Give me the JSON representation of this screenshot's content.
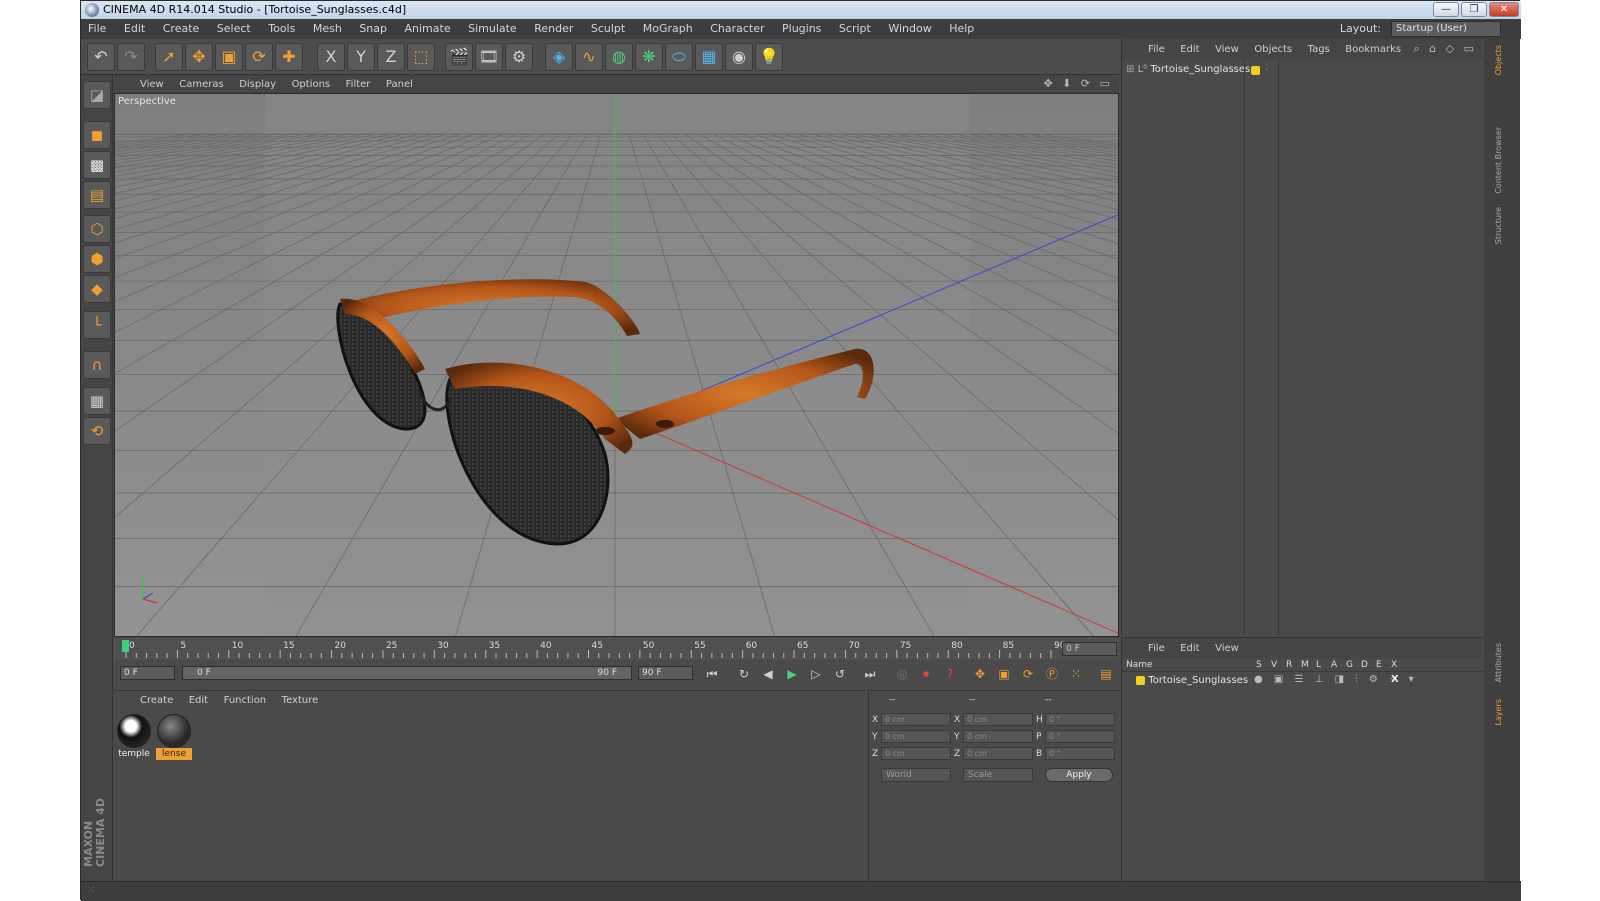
{
  "window": {
    "title": "CINEMA 4D R14.014 Studio - [Tortoise_Sunglasses.c4d]"
  },
  "menubar": {
    "items": [
      "File",
      "Edit",
      "Create",
      "Select",
      "Tools",
      "Mesh",
      "Snap",
      "Animate",
      "Simulate",
      "Render",
      "Sculpt",
      "MoGraph",
      "Character",
      "Plugins",
      "Script",
      "Window",
      "Help"
    ],
    "layout_label": "Layout:",
    "layout_value": "Startup (User)"
  },
  "toolbar": {
    "axis_x": "X",
    "axis_y": "Y",
    "axis_z": "Z"
  },
  "viewport": {
    "menu": [
      "View",
      "Cameras",
      "Display",
      "Options",
      "Filter",
      "Panel"
    ],
    "camera_label": "Perspective",
    "icon_strip": "✥ ⬇ ⟳ ▭"
  },
  "timeline": {
    "ticks": [
      "0",
      "5",
      "10",
      "15",
      "20",
      "25",
      "30",
      "35",
      "40",
      "45",
      "50",
      "55",
      "60",
      "65",
      "70",
      "75",
      "80",
      "85",
      "90"
    ],
    "current_frame": "0 F"
  },
  "playbar": {
    "start": "0 F",
    "range_start": "0 F",
    "range_end": "90 F",
    "end": "90 F"
  },
  "materials": {
    "menu": [
      "Create",
      "Edit",
      "Function",
      "Texture"
    ],
    "items": [
      {
        "name": "temple"
      },
      {
        "name": "lense"
      }
    ]
  },
  "coordinates": {
    "col_headers": [
      "--",
      "--",
      "--"
    ],
    "rows": [
      {
        "a": "X",
        "b": "X",
        "c": "H",
        "v1": "0 cm",
        "v2": "0 cm",
        "v3": "0 °"
      },
      {
        "a": "Y",
        "b": "Y",
        "c": "P",
        "v1": "0 cm",
        "v2": "0 cm",
        "v3": "0 °"
      },
      {
        "a": "Z",
        "b": "Z",
        "c": "B",
        "v1": "0 cm",
        "v2": "0 cm",
        "v3": "0 °"
      }
    ],
    "mode": "World",
    "scale": "Scale",
    "apply": "Apply"
  },
  "objects": {
    "menu": [
      "File",
      "Edit",
      "View",
      "Objects",
      "Tags",
      "Bookmarks"
    ],
    "tree": [
      {
        "name": "Tortoise_Sunglasses"
      }
    ]
  },
  "layers": {
    "menu": [
      "File",
      "Edit",
      "View"
    ],
    "col_name": "Name",
    "cols": [
      "S",
      "V",
      "R",
      "M",
      "L",
      "A",
      "G",
      "D",
      "E",
      "X"
    ],
    "rows": [
      {
        "name": "Tortoise_Sunglasses"
      }
    ]
  },
  "sidetabs": [
    "Objects",
    "Content Browser",
    "Structure",
    "Attributes",
    "Layers"
  ],
  "logo": "MAXON CINEMA 4D",
  "colors": {
    "accent": "#f0a030",
    "axis_x": "#c83a3a",
    "axis_y": "#3ac83a",
    "axis_z": "#3a4ac8",
    "layer_dot": "#f0d020"
  }
}
